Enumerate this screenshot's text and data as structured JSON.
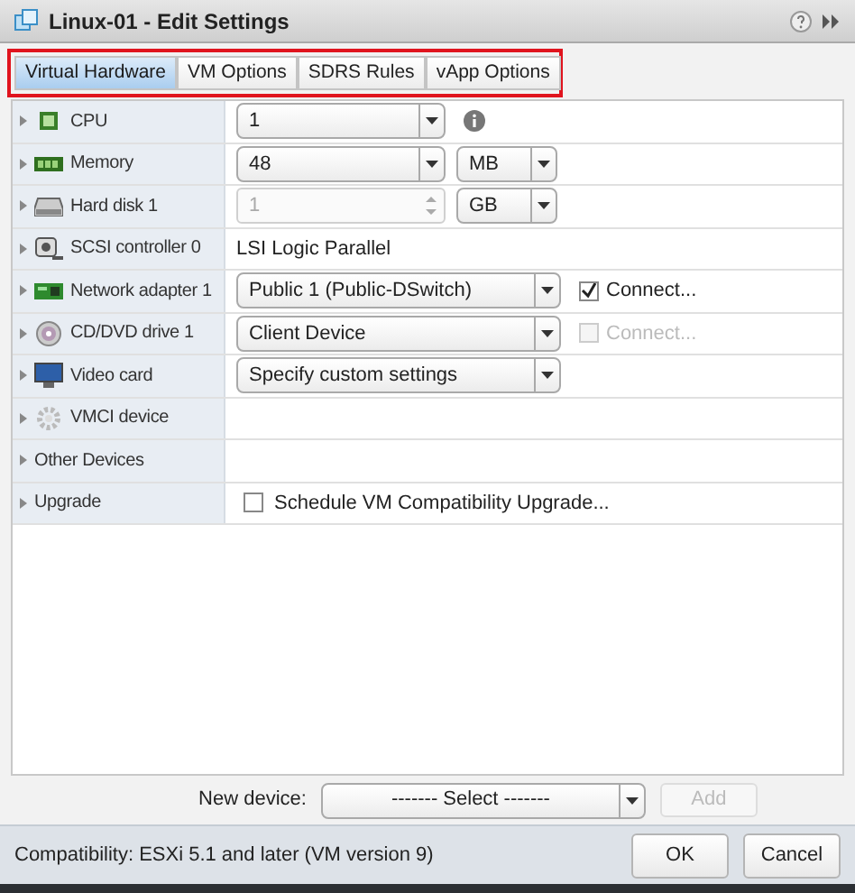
{
  "window": {
    "title": "Linux-01 - Edit Settings"
  },
  "tabs": [
    {
      "label": "Virtual Hardware",
      "selected": true
    },
    {
      "label": "VM Options",
      "selected": false
    },
    {
      "label": "SDRS Rules",
      "selected": false
    },
    {
      "label": "vApp Options",
      "selected": false
    }
  ],
  "rows": [
    {
      "label": "CPU",
      "kind": "select",
      "value": "1",
      "info": true
    },
    {
      "label": "Memory",
      "kind": "select",
      "value": "48",
      "unit": "MB"
    },
    {
      "label": "Hard disk 1",
      "kind": "spinner",
      "value": "1",
      "disabled": true,
      "unit": "GB"
    },
    {
      "label": "SCSI controller 0",
      "kind": "text",
      "value": "LSI Logic Parallel"
    },
    {
      "label": "Network adapter 1",
      "kind": "select",
      "value": "Public 1 (Public-DSwitch)",
      "connect": {
        "label": "Connect...",
        "checked": true,
        "disabled": false
      }
    },
    {
      "label": "CD/DVD drive 1",
      "kind": "select",
      "value": "Client Device",
      "connect": {
        "label": "Connect...",
        "checked": false,
        "disabled": true
      }
    },
    {
      "label": "Video card",
      "kind": "select",
      "value": "Specify custom settings"
    },
    {
      "label": "VMCI device",
      "kind": "empty"
    },
    {
      "label": "Other Devices",
      "kind": "empty"
    },
    {
      "label": "Upgrade",
      "kind": "checkbox",
      "value": "Schedule VM Compatibility Upgrade...",
      "checked": false
    }
  ],
  "new_device": {
    "label": "New device:",
    "value": "------- Select -------",
    "button": "Add",
    "button_disabled": true
  },
  "footer": {
    "compatibility": "Compatibility: ESXi 5.1 and later (VM version 9)",
    "buttons": [
      "OK",
      "Cancel"
    ]
  }
}
